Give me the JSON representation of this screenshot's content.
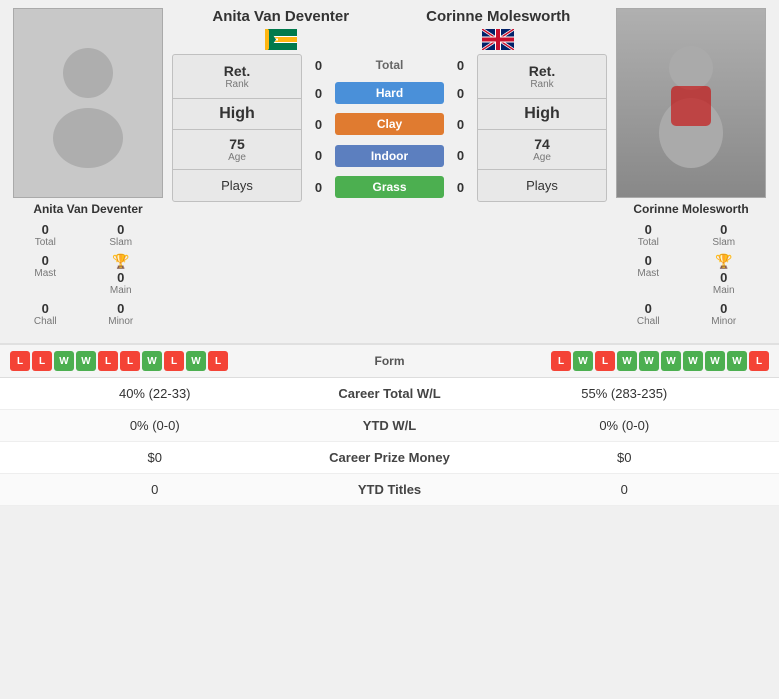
{
  "players": {
    "left": {
      "name": "Anita Van Deventer",
      "flag": "ZA",
      "rank_label": "Ret.",
      "rank_sub": "Rank",
      "stats": {
        "total_val": "0",
        "total_lbl": "Total",
        "slam_val": "0",
        "slam_lbl": "Slam",
        "mast_val": "0",
        "mast_lbl": "Mast",
        "main_val": "0",
        "main_lbl": "Main",
        "chall_val": "0",
        "chall_lbl": "Chall",
        "minor_val": "0",
        "minor_lbl": "Minor"
      },
      "age_val": "75",
      "age_lbl": "Age",
      "plays_lbl": "Plays",
      "rank_highlight": "High"
    },
    "right": {
      "name": "Corinne Molesworth",
      "flag": "GB",
      "rank_label": "Ret.",
      "rank_sub": "Rank",
      "stats": {
        "total_val": "0",
        "total_lbl": "Total",
        "slam_val": "0",
        "slam_lbl": "Slam",
        "mast_val": "0",
        "mast_lbl": "Mast",
        "main_val": "0",
        "main_lbl": "Main",
        "chall_val": "0",
        "chall_lbl": "Chall",
        "minor_val": "0",
        "minor_lbl": "Minor"
      },
      "age_val": "74",
      "age_lbl": "Age",
      "plays_lbl": "Plays",
      "rank_highlight": "High"
    }
  },
  "scores": {
    "total_label": "Total",
    "total_left": "0",
    "total_right": "0",
    "hard_label": "Hard",
    "hard_left": "0",
    "hard_right": "0",
    "clay_label": "Clay",
    "clay_left": "0",
    "clay_right": "0",
    "indoor_label": "Indoor",
    "indoor_left": "0",
    "indoor_right": "0",
    "grass_label": "Grass",
    "grass_left": "0",
    "grass_right": "0"
  },
  "form": {
    "label": "Form",
    "left_form": [
      "L",
      "L",
      "W",
      "W",
      "L",
      "L",
      "W",
      "L",
      "W",
      "L"
    ],
    "right_form": [
      "L",
      "W",
      "L",
      "W",
      "W",
      "W",
      "W",
      "W",
      "W",
      "L"
    ]
  },
  "bottom_stats": [
    {
      "label": "Career Total W/L",
      "left": "40% (22-33)",
      "right": "55% (283-235)"
    },
    {
      "label": "YTD W/L",
      "left": "0% (0-0)",
      "right": "0% (0-0)"
    },
    {
      "label": "Career Prize Money",
      "left": "$0",
      "right": "$0"
    },
    {
      "label": "YTD Titles",
      "left": "0",
      "right": "0"
    }
  ]
}
